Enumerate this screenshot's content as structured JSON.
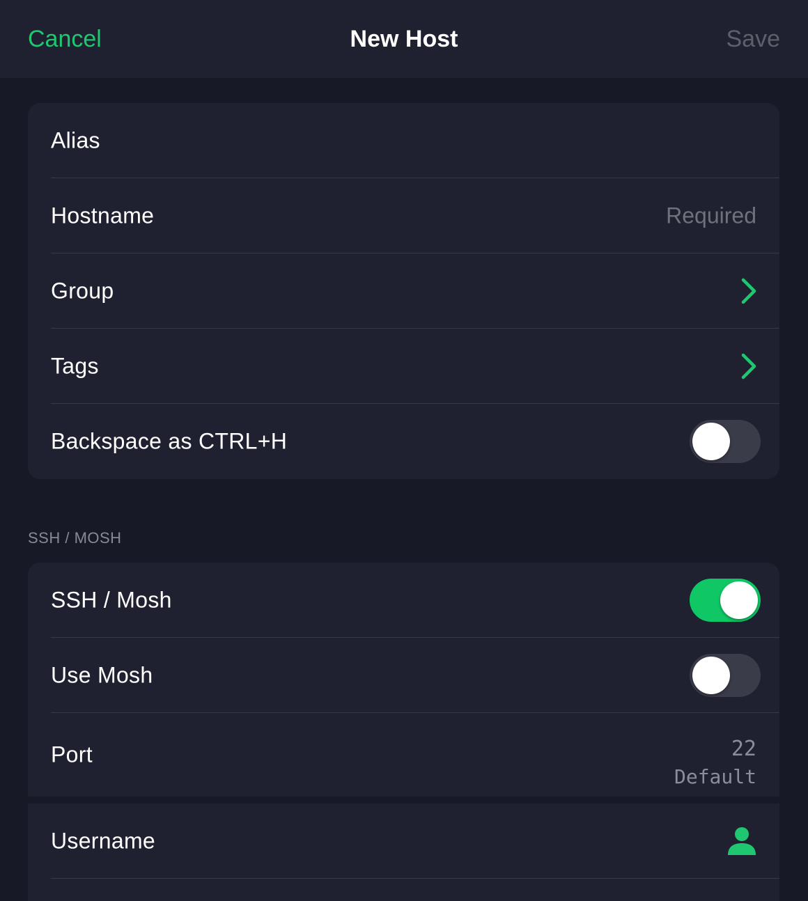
{
  "nav": {
    "cancel_label": "Cancel",
    "title": "New Host",
    "save_label": "Save"
  },
  "general": {
    "alias": {
      "label": "Alias"
    },
    "hostname": {
      "label": "Hostname",
      "placeholder": "Required"
    },
    "group": {
      "label": "Group",
      "icon": "chevron-right-icon"
    },
    "tags": {
      "label": "Tags",
      "icon": "chevron-right-icon"
    },
    "backspace": {
      "label": "Backspace as CTRL+H",
      "enabled": false
    }
  },
  "ssh_section": {
    "header": "SSH / MOSH",
    "ssh_mosh": {
      "label": "SSH / Mosh",
      "enabled": true
    },
    "use_mosh": {
      "label": "Use Mosh",
      "enabled": false
    },
    "port": {
      "label": "Port",
      "value": "22",
      "hint": "Default"
    },
    "username": {
      "label": "Username",
      "icon": "user-icon"
    }
  },
  "colors": {
    "accent": "#1fc870",
    "background": "#171a26",
    "card": "#1f2130",
    "toggle_off": "#3a3c49",
    "disabled_text": "#5d606b"
  }
}
